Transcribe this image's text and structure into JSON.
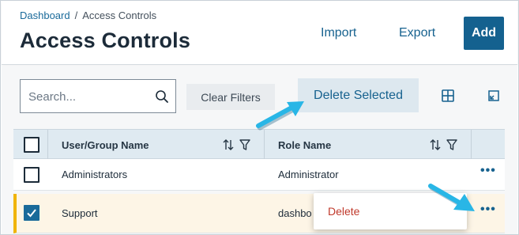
{
  "breadcrumb": {
    "home": "Dashboard",
    "separator": "/",
    "current": "Access Controls"
  },
  "header": {
    "title": "Access Controls",
    "import_label": "Import",
    "export_label": "Export",
    "add_label": "Add"
  },
  "toolbar": {
    "search_placeholder": "Search...",
    "clear_filters_label": "Clear Filters",
    "delete_selected_label": "Delete Selected",
    "icons": [
      "search-icon",
      "grid-icon",
      "collapse-icon"
    ]
  },
  "table": {
    "columns": [
      "User/Group Name",
      "Role Name"
    ],
    "rows": [
      {
        "name": "Administrators",
        "role": "Administrator",
        "checked": false
      },
      {
        "name": "Support",
        "role": "dashbo",
        "checked": true
      }
    ]
  },
  "row_menu": {
    "delete_label": "Delete"
  },
  "colors": {
    "accent": "#14618f",
    "link": "#17628f",
    "header_bg": "#dfeaf1",
    "selected_row_bg": "#fdf5e6",
    "selected_row_border": "#f0b400",
    "danger": "#c0392b",
    "annotation_arrow": "#29b6e6"
  }
}
